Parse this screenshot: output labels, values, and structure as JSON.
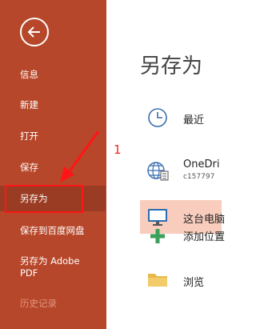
{
  "sidebar": {
    "back_label": "back",
    "items": [
      {
        "label": "信息"
      },
      {
        "label": "新建"
      },
      {
        "label": "打开"
      },
      {
        "label": "保存"
      },
      {
        "label": "另存为"
      },
      {
        "label": "保存到百度网盘"
      },
      {
        "label": "另存为 Adobe PDF"
      },
      {
        "label": "历史记录"
      }
    ]
  },
  "annotation": {
    "number": "1"
  },
  "main": {
    "title": "另存为",
    "locations": [
      {
        "label": "最近",
        "sub": ""
      },
      {
        "label": "OneDri",
        "sub": "c157797"
      },
      {
        "label": "这台电脑",
        "sub": ""
      },
      {
        "label": "添加位置",
        "sub": ""
      },
      {
        "label": "浏览",
        "sub": ""
      }
    ]
  },
  "colors": {
    "sidebar_bg": "#b7472a",
    "sidebar_selected": "#9a3c23",
    "location_selected": "#f8cdbd",
    "annotation_red": "#ff1515"
  }
}
